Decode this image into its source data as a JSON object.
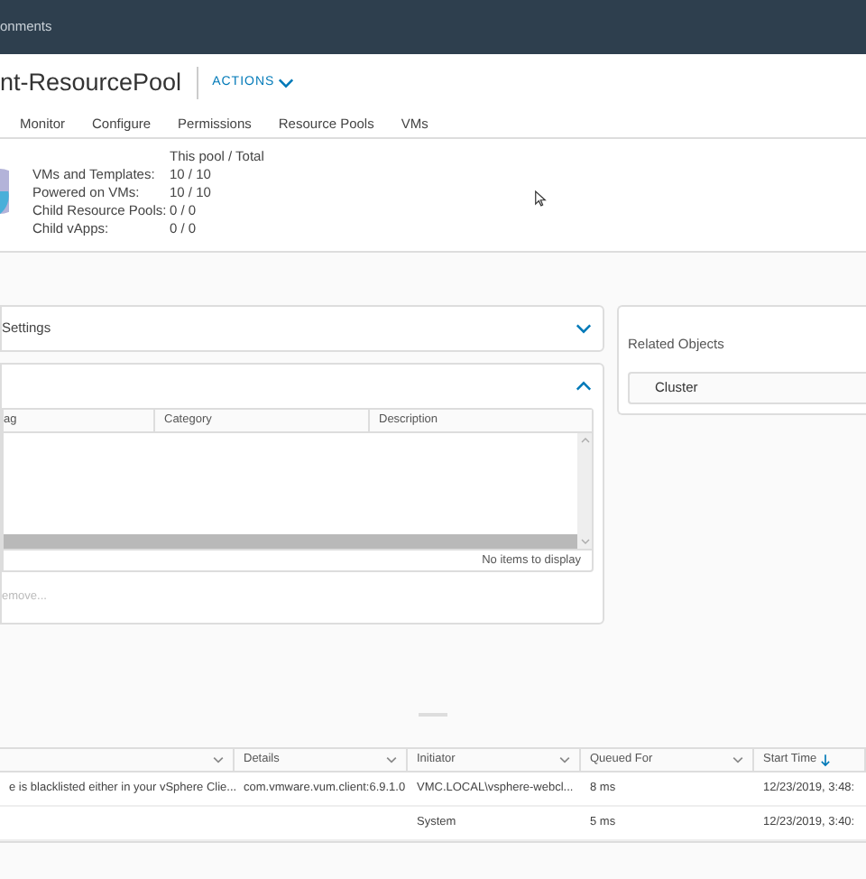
{
  "header": {
    "breadcrumb": "onments"
  },
  "title": {
    "text": "nt-ResourcePool",
    "actions": "ACTIONS"
  },
  "tabs": [
    {
      "label": "Monitor",
      "selected": false
    },
    {
      "label": "Configure",
      "selected": false
    },
    {
      "label": "Permissions",
      "selected": false
    },
    {
      "label": "Resource Pools",
      "selected": false
    },
    {
      "label": "VMs",
      "selected": false
    }
  ],
  "summary": {
    "heading": "This pool / Total",
    "rows": [
      {
        "label": "VMs and Templates:",
        "value": "10 / 10"
      },
      {
        "label": "Powered on VMs:",
        "value": "10 / 10"
      },
      {
        "label": "Child Resource Pools:",
        "value": "0 / 0"
      },
      {
        "label": "Child vApps:",
        "value": "0 / 0"
      }
    ]
  },
  "settings_card": {
    "title": "Settings",
    "expanded": false
  },
  "tags_card": {
    "expanded": true,
    "columns": [
      "ag",
      "Category",
      "Description"
    ],
    "empty_text": "No items to display",
    "remove_link": "emove..."
  },
  "related_objects": {
    "title": "Related Objects",
    "items": [
      "Cluster"
    ]
  },
  "tasks": {
    "columns": [
      {
        "sorted": false
      },
      {
        "label": "Details",
        "sorted": false
      },
      {
        "label": "Initiator",
        "sorted": false
      },
      {
        "label": "Queued For",
        "sorted": false
      },
      {
        "label": "Start Time",
        "sorted": true
      }
    ],
    "rows": [
      [
        "e is blacklisted either in your vSphere Clie...",
        "com.vmware.vum.client:6.9.1.0",
        "VMC.LOCAL\\vsphere-webcl...",
        "8 ms",
        "12/23/2019, 3:48:"
      ],
      [
        "",
        "",
        "System",
        "5 ms",
        "12/23/2019, 3:40:"
      ]
    ]
  }
}
